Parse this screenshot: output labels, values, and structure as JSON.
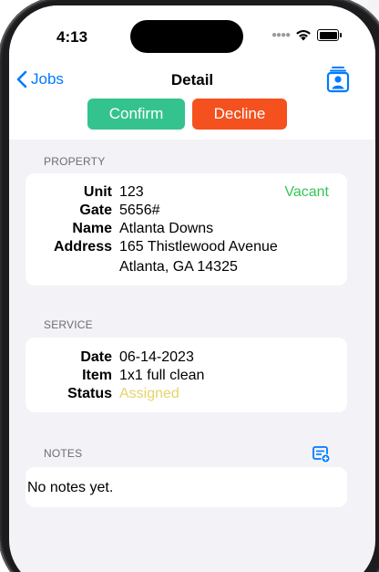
{
  "status_bar": {
    "time": "4:13"
  },
  "nav": {
    "back_label": "Jobs",
    "title": "Detail"
  },
  "actions": {
    "confirm_label": "Confirm",
    "decline_label": "Decline"
  },
  "property": {
    "section_label": "PROPERTY",
    "occupancy": "Vacant",
    "fields": [
      {
        "key": "Unit",
        "value": "123"
      },
      {
        "key": "Gate",
        "value": "5656#"
      },
      {
        "key": "Name",
        "value": "Atlanta Downs"
      },
      {
        "key": "Address",
        "value": "165 Thistlewood Avenue",
        "value2": "Atlanta, GA 14325"
      }
    ]
  },
  "service": {
    "section_label": "SERVICE",
    "fields": [
      {
        "key": "Date",
        "value": "06-14-2023"
      },
      {
        "key": "Item",
        "value": "1x1 full clean"
      },
      {
        "key": "Status",
        "value": "Assigned"
      }
    ]
  },
  "notes": {
    "section_label": "NOTES",
    "empty_text": "No notes yet."
  },
  "colors": {
    "accent": "#007aff",
    "confirm": "#34c38f",
    "decline": "#f4511e",
    "vacant": "#34c759",
    "assigned": "#e5d36a",
    "background": "#f2f2f7"
  },
  "icons": {
    "back": "chevron-left-icon",
    "contact": "contact-card-icon",
    "notes_add": "note-add-icon",
    "wifi": "wifi-icon",
    "battery": "battery-icon"
  }
}
